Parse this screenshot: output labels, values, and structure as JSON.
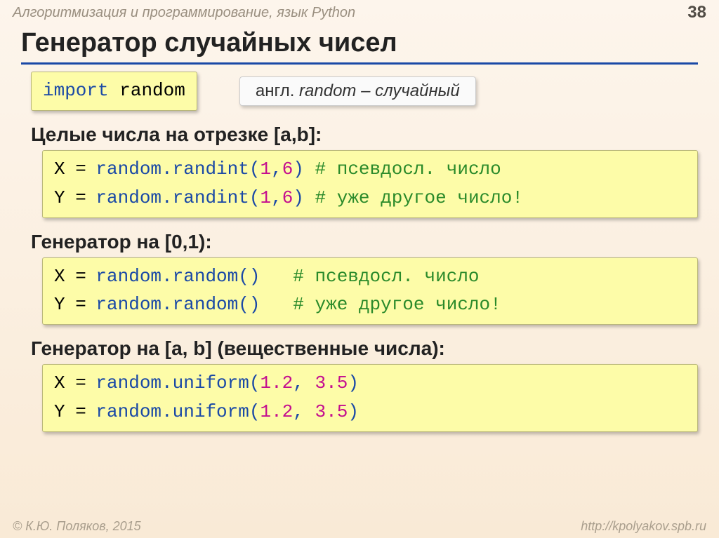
{
  "header": {
    "breadcrumb": "Алгоритмизация и программирование, язык Python",
    "page": "38"
  },
  "title": "Генератор случайных чисел",
  "import_box": {
    "kw": "import",
    "mod": "random"
  },
  "note": {
    "prefix": "англ. ",
    "word": "random",
    "tail": " – случайный"
  },
  "sec1": {
    "heading": "Целые числа на отрезке [a,b]:",
    "l1": {
      "v": "X",
      "eq": " = ",
      "fn": "random.randint(",
      "a": "1",
      "c": ",",
      "b": "6",
      "cp": ")",
      "sp": " ",
      "cmt": "# псевдосл. число"
    },
    "l2": {
      "v": "Y",
      "eq": " = ",
      "fn": "random.randint(",
      "a": "1",
      "c": ",",
      "b": "6",
      "cp": ")",
      "sp": " ",
      "cmt": "# уже другое число!"
    }
  },
  "sec2": {
    "heading": "Генератор на [0,1):",
    "l1": {
      "v": "X",
      "eq": " = ",
      "fn": "random.random()",
      "sp": "   ",
      "cmt": "# псевдосл. число"
    },
    "l2": {
      "v": "Y",
      "eq": " = ",
      "fn": "random.random()",
      "sp": "   ",
      "cmt": "# уже другое число!"
    }
  },
  "sec3": {
    "heading": "Генератор на [a, b] (вещественные числа):",
    "l1": {
      "v": "X",
      "eq": " = ",
      "fn": "random.uniform(",
      "a": "1.2",
      "c": ", ",
      "b": "3.5",
      "cp": ")"
    },
    "l2": {
      "v": "Y",
      "eq": " = ",
      "fn": "random.uniform(",
      "a": "1.2",
      "c": ", ",
      "b": "3.5",
      "cp": ")"
    }
  },
  "footer": {
    "left": "© К.Ю. Поляков, 2015",
    "right": "http://kpolyakov.spb.ru"
  }
}
